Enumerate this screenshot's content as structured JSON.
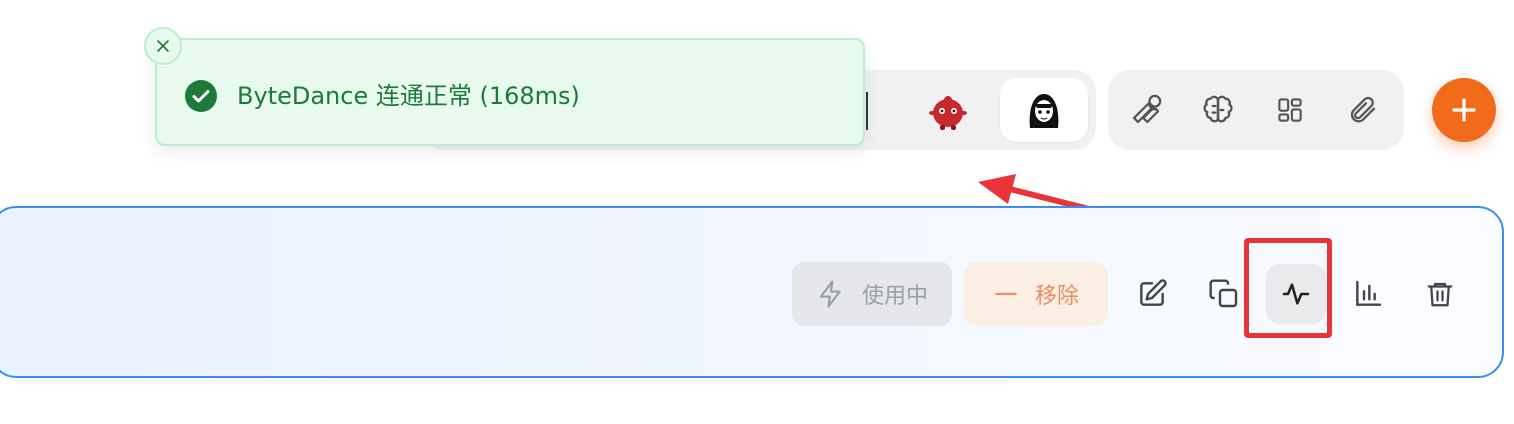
{
  "toast": {
    "message": "ByteDance 连通正常 (168ms)",
    "status": "success",
    "close_icon": "close-icon",
    "check_icon": "check-circle-icon"
  },
  "avatars": [
    {
      "name": "red-mascot-avatar",
      "active": false
    },
    {
      "name": "anime-girl-avatar",
      "active": true
    }
  ],
  "tools": [
    "wrench-icon",
    "brain-icon",
    "apps-grid-icon",
    "paperclip-icon"
  ],
  "add_button": {
    "icon": "plus-icon"
  },
  "provider_card": {
    "in_use_label": "使用中",
    "remove_label": "移除",
    "actions": [
      "edit-icon",
      "copy-icon",
      "test-connection-icon",
      "stats-icon",
      "trash-icon"
    ]
  },
  "colors": {
    "accent_orange": "#f26a1b",
    "toast_green": "#1d7a3a",
    "card_border": "#3a8ff0",
    "annotation_red": "#e8343a"
  }
}
